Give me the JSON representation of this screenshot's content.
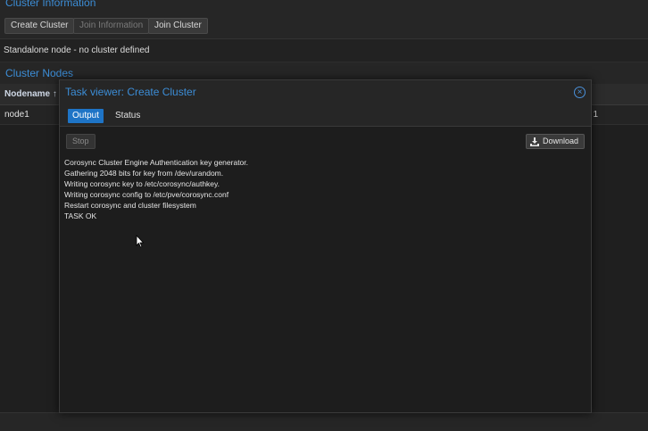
{
  "background": {
    "panel_title": "Cluster Information",
    "toolbar": {
      "create_cluster": "Create Cluster",
      "join_information": "Join Information",
      "join_cluster": "Join Cluster"
    },
    "info_text": "Standalone node - no cluster defined",
    "nodes_title": "Cluster Nodes",
    "grid": {
      "header": "Nodename ↑",
      "rows": [
        {
          "nodename": "node1",
          "id": "1"
        }
      ]
    }
  },
  "modal": {
    "title": "Task viewer: Create Cluster",
    "tabs": [
      {
        "label": "Output",
        "active": true
      },
      {
        "label": "Status",
        "active": false
      }
    ],
    "stop_label": "Stop",
    "download_label": "Download",
    "log_lines": [
      "Corosync Cluster Engine Authentication key generator.",
      "Gathering 2048 bits for key from /dev/urandom.",
      "Writing corosync key to /etc/corosync/authkey.",
      "Writing corosync config to /etc/pve/corosync.conf",
      "Restart corosync and cluster filesystem",
      "TASK OK"
    ]
  },
  "colors": {
    "accent": "#3c8dd6",
    "active_tab": "#1e74c6",
    "background": "#1f1f1f"
  },
  "icons": {
    "close": "close-circle-icon",
    "download": "download-icon",
    "cursor": "mouse-pointer-icon"
  }
}
